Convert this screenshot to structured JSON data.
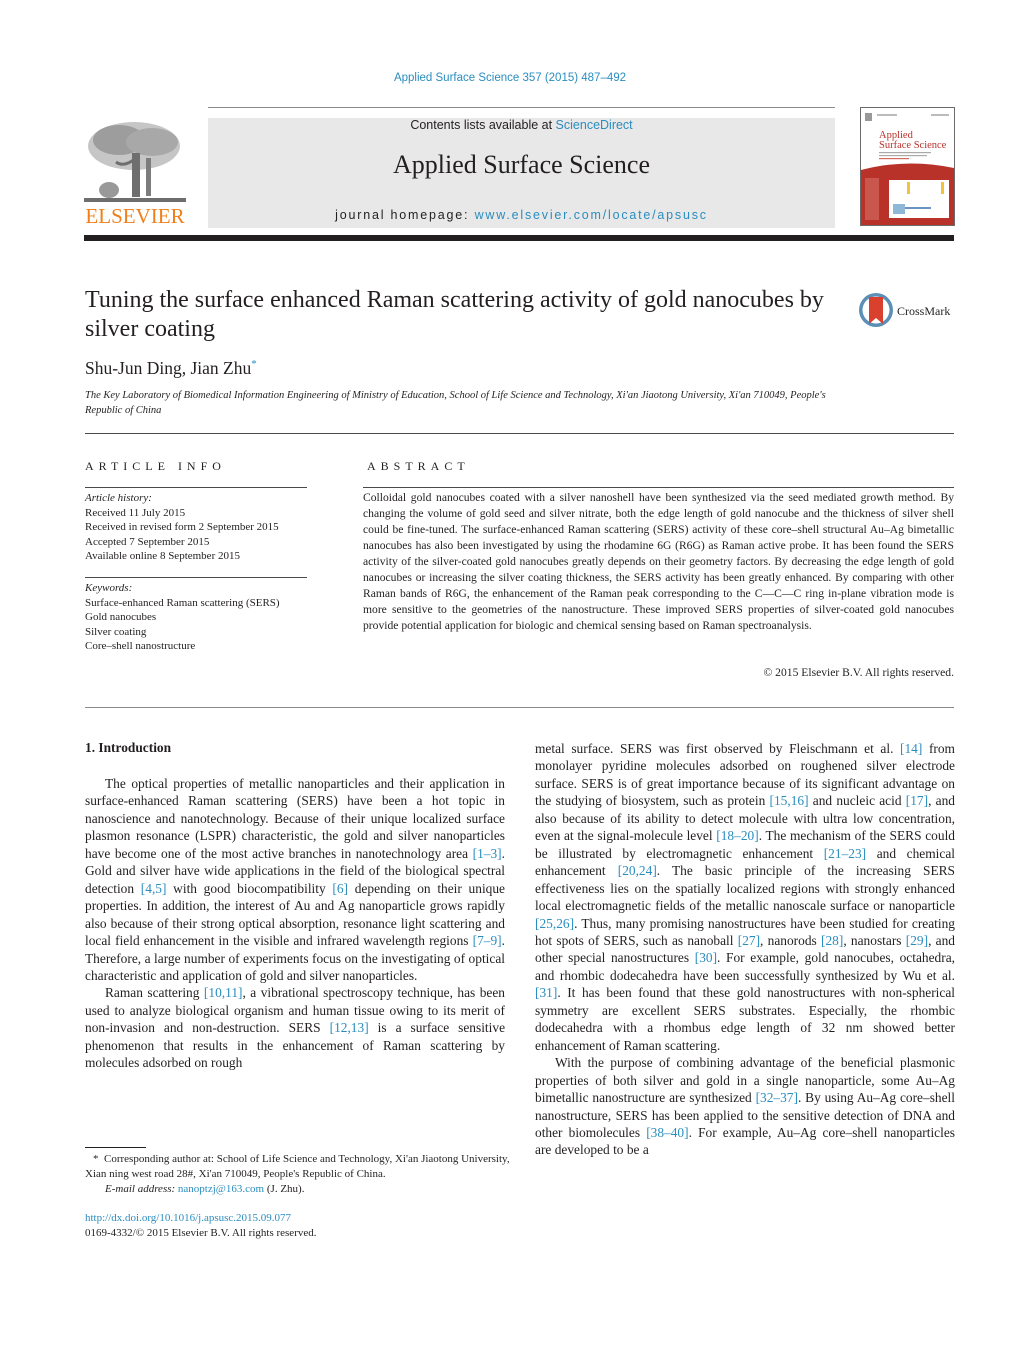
{
  "header": {
    "citation": "Applied Surface Science 357 (2015) 487–492",
    "contents_prefix": "Contents lists available at ",
    "contents_link": "ScienceDirect",
    "journal_title": "Applied Surface Science",
    "homepage_prefix": "journal homepage: ",
    "homepage_link": "www.elsevier.com/locate/apsusc",
    "publisher_logo_text": "ELSEVIER",
    "cover_title_line1": "Applied",
    "cover_title_line2": "Surface Science",
    "colors": {
      "link": "#2a8dbf",
      "elsevier_orange": "#f07f1a",
      "banner_bg": "#e8e8e8",
      "cover_red": "#b8322a"
    }
  },
  "article": {
    "title": "Tuning the surface enhanced Raman scattering activity of gold nanocubes by silver coating",
    "crossmark_label": "CrossMark",
    "authors": "Shu-Jun Ding, Jian Zhu",
    "corresponding_mark": "*",
    "affiliation": "The Key Laboratory of Biomedical Information Engineering of Ministry of Education, School of Life Science and Technology, Xi'an Jiaotong University, Xi'an 710049, People's Republic of China"
  },
  "article_info": {
    "heading": "ARTICLE INFO",
    "history_label": "Article history:",
    "history": [
      "Received 11 July 2015",
      "Received in revised form 2 September 2015",
      "Accepted 7 September 2015",
      "Available online 8 September 2015"
    ],
    "keywords_label": "Keywords:",
    "keywords": [
      "Surface-enhanced Raman scattering (SERS)",
      "Gold nanocubes",
      "Silver coating",
      "Core–shell nanostructure"
    ]
  },
  "abstract": {
    "heading": "ABSTRACT",
    "text": "Colloidal gold nanocubes coated with a silver nanoshell have been synthesized via the seed mediated growth method. By changing the volume of gold seed and silver nitrate, both the edge length of gold nanocube and the thickness of silver shell could be fine-tuned. The surface-enhanced Raman scattering (SERS) activity of these core–shell structural Au–Ag bimetallic nanocubes has also been investigated by using the rhodamine 6G (R6G) as Raman active probe. It has been found the SERS activity of the silver-coated gold nanocubes greatly depends on their geometry factors. By decreasing the edge length of gold nanocubes or increasing the silver coating thickness, the SERS activity has been greatly enhanced. By comparing with other Raman bands of R6G, the enhancement of the Raman peak corresponding to the C—C—C ring in-plane vibration mode is more sensitive to the geometries of the nanostructure. These improved SERS properties of silver-coated gold nanocubes provide potential application for biologic and chemical sensing based on Raman spectroanalysis.",
    "copyright": "© 2015 Elsevier B.V. All rights reserved."
  },
  "introduction": {
    "heading": "1.  Introduction",
    "left_paragraphs": [
      [
        {
          "t": "The optical properties of metallic nanoparticles and their application in surface-enhanced Raman scattering (SERS) have been a hot topic in nanoscience and nanotechnology. Because of their unique localized surface plasmon resonance (LSPR) characteristic, the gold and silver nanoparticles have become one of the most active branches in nanotechnology area "
        },
        {
          "r": "[1–3]"
        },
        {
          "t": ". Gold and silver have wide applications in the field of the biological spectral detection "
        },
        {
          "r": "[4,5]"
        },
        {
          "t": " with good biocompatibility "
        },
        {
          "r": "[6]"
        },
        {
          "t": " depending on their unique properties. In addition, the interest of Au and Ag nanoparticle grows rapidly also because of their strong optical absorption, resonance light scattering and local field enhancement in the visible and infrared wavelength regions "
        },
        {
          "r": "[7–9]"
        },
        {
          "t": ". Therefore, a large number of experiments focus on the investigating of optical characteristic and application of gold and silver nanoparticles."
        }
      ],
      [
        {
          "t": "Raman scattering "
        },
        {
          "r": "[10,11]"
        },
        {
          "t": ", a vibrational spectroscopy technique, has been used to analyze biological organism and human tissue owing to its merit of non-invasion and non-destruction. SERS "
        },
        {
          "r": "[12,13]"
        },
        {
          "t": " is a surface sensitive phenomenon that results in the enhancement of Raman scattering by molecules adsorbed on rough"
        }
      ]
    ],
    "right_paragraphs": [
      [
        {
          "t": "metal surface. SERS was first observed by Fleischmann et al. "
        },
        {
          "r": "[14]"
        },
        {
          "t": " from monolayer pyridine molecules adsorbed on roughened silver electrode surface. SERS is of great importance because of its significant advantage on the studying of biosystem, such as protein "
        },
        {
          "r": "[15,16]"
        },
        {
          "t": " and nucleic acid "
        },
        {
          "r": "[17]"
        },
        {
          "t": ", and also because of its ability to detect molecule with ultra low concentration, even at the signal-molecule level "
        },
        {
          "r": "[18–20]"
        },
        {
          "t": ". The mechanism of the SERS could be illustrated by electromagnetic enhancement "
        },
        {
          "r": "[21–23]"
        },
        {
          "t": " and chemical enhancement "
        },
        {
          "r": "[20,24]"
        },
        {
          "t": ". The basic principle of the increasing SERS effectiveness lies on the spatially localized regions with strongly enhanced local electromagnetic fields of the metallic nanoscale surface or nanoparticle "
        },
        {
          "r": "[25,26]"
        },
        {
          "t": ". Thus, many promising nanostructures have been studied for creating hot spots of SERS, such as nanoball "
        },
        {
          "r": "[27]"
        },
        {
          "t": ", nanorods "
        },
        {
          "r": "[28]"
        },
        {
          "t": ", nanostars "
        },
        {
          "r": "[29]"
        },
        {
          "t": ", and other special nanostructures "
        },
        {
          "r": "[30]"
        },
        {
          "t": ". For example, gold nanocubes, octahedra, and rhombic dodecahedra have been successfully synthesized by Wu et al. "
        },
        {
          "r": "[31]"
        },
        {
          "t": ". It has been found that these gold nanostructures with non-spherical symmetry are excellent SERS substrates. Especially, the rhombic dodecahedra with a rhombus edge length of 32 nm showed better enhancement of Raman scattering."
        }
      ],
      [
        {
          "t": "With the purpose of combining advantage of the beneficial plasmonic properties of both silver and gold in a single nanoparticle, some Au–Ag bimetallic nanostructure are synthesized "
        },
        {
          "r": "[32–37]"
        },
        {
          "t": ". By using Au–Ag core–shell nanostructure, SERS has been applied to the sensitive detection of DNA and other biomolecules "
        },
        {
          "r": "[38–40]"
        },
        {
          "t": ". For example, Au–Ag core–shell nanoparticles are developed to be a"
        }
      ]
    ]
  },
  "footnote": {
    "mark": "*",
    "corresponding": "Corresponding author at: School of Life Science and Technology, Xi'an Jiaotong University, Xian ning west road 28#, Xi'an 710049, People's Republic of China.",
    "email_label": "E-mail address: ",
    "email": "nanoptzj@163.com",
    "email_suffix": " (J. Zhu).",
    "doi": "http://dx.doi.org/10.1016/j.apsusc.2015.09.077",
    "issn_line": "0169-4332/© 2015 Elsevier B.V. All rights reserved."
  }
}
